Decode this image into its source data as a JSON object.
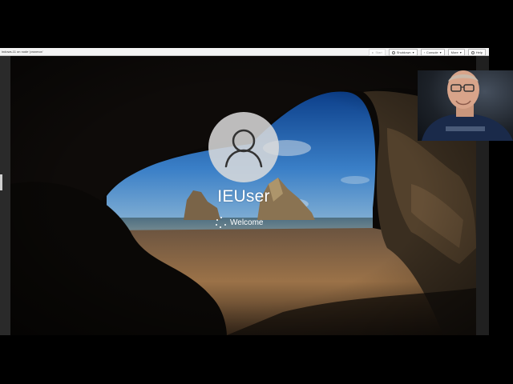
{
  "console": {
    "title": "indows-11 on node 'proxmox'",
    "buttons": [
      {
        "label": "Start",
        "icon": "play-icon",
        "enabled": false
      },
      {
        "label": "Shutdown",
        "icon": "power-icon",
        "enabled": true
      },
      {
        "label": "Console",
        "icon": "chevron-down-icon",
        "enabled": true
      },
      {
        "label": "More",
        "icon": "chevron-down-icon",
        "enabled": true
      },
      {
        "label": "Help",
        "icon": "help-icon",
        "enabled": true
      }
    ]
  },
  "lockscreen": {
    "user_name": "IEUser",
    "status_text": "Welcome"
  },
  "colors": {
    "toolbar_bg": "#f3f3f3",
    "stage_bg": "#050505",
    "avatar_circle": "#dcdcdc",
    "text": "#ffffff"
  }
}
